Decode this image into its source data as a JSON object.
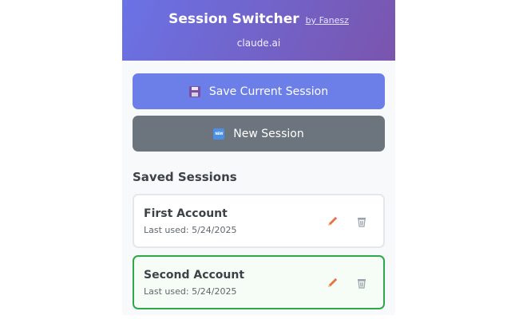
{
  "header": {
    "title": "Session Switcher",
    "byline": "by Fanesz",
    "domain": "claude.ai"
  },
  "buttons": {
    "save": {
      "label": "Save Current Session",
      "icon": "floppy-disk-icon"
    },
    "new": {
      "label": "New Session",
      "icon": "new-badge-icon",
      "badge_text": "NEW"
    }
  },
  "saved_sessions": {
    "title": "Saved Sessions",
    "items": [
      {
        "name": "First Account",
        "last_used": "Last used: 5/24/2025",
        "active": false
      },
      {
        "name": "Second Account",
        "last_used": "Last used: 5/24/2025",
        "active": true
      }
    ]
  },
  "colors": {
    "header_gradient_start": "#6a72e6",
    "header_gradient_end": "#7a55ad",
    "primary_button": "#6c7ee8",
    "secondary_button": "#6c757d",
    "active_border": "#2fa84a",
    "edit_icon": "#e8743b",
    "delete_icon": "#9aa3ad"
  }
}
